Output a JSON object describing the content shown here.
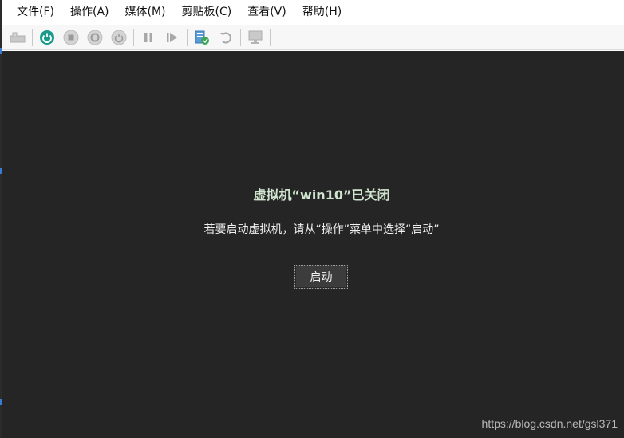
{
  "menu": {
    "items": [
      "文件(F)",
      "操作(A)",
      "媒体(M)",
      "剪贴板(C)",
      "查看(V)",
      "帮助(H)"
    ]
  },
  "toolbar": {
    "buttons": [
      {
        "name": "ctrl-alt-del-icon",
        "enabled": false
      },
      {
        "name": "power-on-icon",
        "enabled": true,
        "color": "#1a9a8a"
      },
      {
        "name": "turn-off-icon",
        "enabled": false
      },
      {
        "name": "shutdown-icon",
        "enabled": false
      },
      {
        "name": "save-state-icon",
        "enabled": false
      },
      {
        "name": "pause-icon",
        "enabled": false
      },
      {
        "name": "reset-icon",
        "enabled": false
      },
      {
        "name": "checkpoint-icon",
        "enabled": true
      },
      {
        "name": "revert-icon",
        "enabled": false
      },
      {
        "name": "enhanced-session-icon",
        "enabled": false
      }
    ]
  },
  "vm": {
    "title": "虚拟机“win10”已关闭",
    "hint": "若要启动虚拟机，请从“操作”菜单中选择“启动”",
    "start_label": "启动"
  },
  "watermark": "https://blog.csdn.net/gsl371",
  "colors": {
    "vm_background": "#252525",
    "title_color": "#cfe5cf",
    "accent": "#1a9a8a"
  }
}
